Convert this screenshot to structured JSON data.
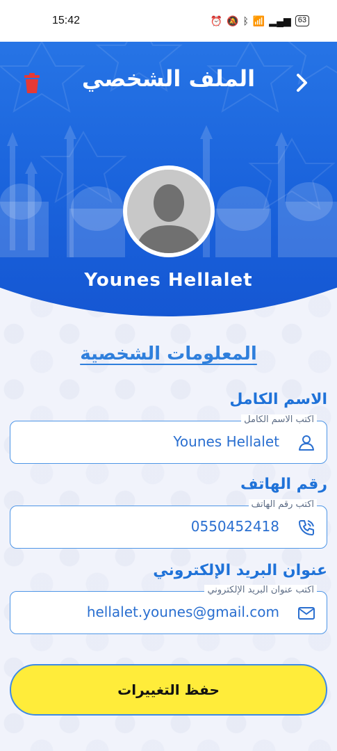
{
  "status_bar": {
    "time": "15:42",
    "battery": "63"
  },
  "header": {
    "title": "الملف الشخصي",
    "back_icon": "chevron-right-icon",
    "delete_icon": "trash-icon"
  },
  "profile": {
    "name": "Younes Hellalet",
    "avatar_icon": "avatar-placeholder-icon"
  },
  "section": {
    "title": "المعلومات الشخصية"
  },
  "fields": [
    {
      "label": "الاسم الكامل",
      "hint": "اكتب الاسم الكامل",
      "value": "Younes Hellalet",
      "icon": "user-icon"
    },
    {
      "label": "رقم الهاتف",
      "hint": "اكتب رقم الهاتف",
      "value": "0550452418",
      "icon": "phone-icon"
    },
    {
      "label": "عنوان البريد الإلكتروني",
      "hint": "اكتب عنوان البريد الإلكتروني",
      "value": "hellalet.younes@gmail.com",
      "icon": "mail-icon"
    }
  ],
  "actions": {
    "save_label": "حفظ التغييرات"
  },
  "colors": {
    "header_blue": "#1a63dc",
    "accent_blue": "#1f72d8",
    "save_yellow": "#ffec3a",
    "delete_red": "#e53935"
  }
}
